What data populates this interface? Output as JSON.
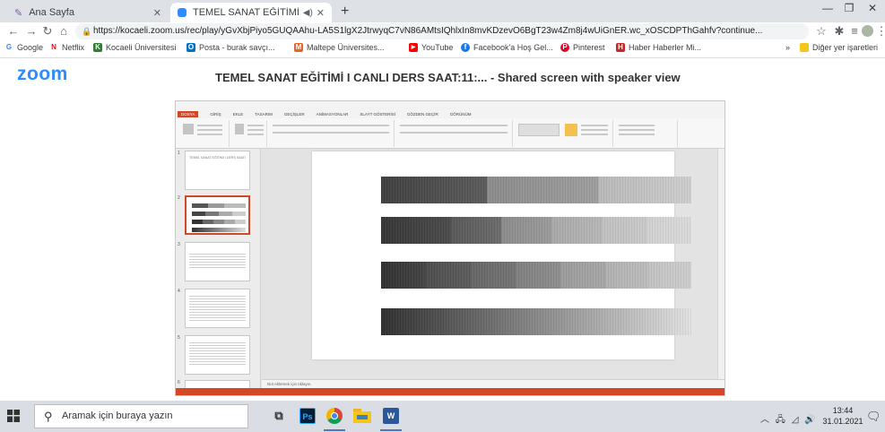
{
  "browser": {
    "tabs": [
      {
        "title": "Ana Sayfa",
        "active": false
      },
      {
        "title": "TEMEL SANAT EĞİTİMİ I CAN",
        "active": true
      }
    ],
    "url": "https://kocaeli.zoom.us/rec/play/yGvXbjPiyo5GUQAAhu-LA5S1lgX2JtrwyqC7vN86AMtsIQhlxIn8mvKDzevO6BgT23w4Zm8j4wUiGnER.wc_xOSCDPThGahfv?continue...",
    "bookmarks": [
      {
        "label": "Google",
        "color": "#4285f4",
        "glyph": "G"
      },
      {
        "label": "Netflix",
        "color": "#e50914",
        "glyph": "N"
      },
      {
        "label": "Kocaeli Üniversitesi",
        "color": "#2e7d32",
        "glyph": "K"
      },
      {
        "label": "Posta - burak savçı...",
        "color": "#0072c6",
        "glyph": "O"
      },
      {
        "label": "Maltepe Üniversites...",
        "color": "#e0662a",
        "glyph": "M"
      },
      {
        "label": "YouTube",
        "color": "#ff0000",
        "glyph": "▶"
      },
      {
        "label": "Facebook'a Hoş Gel...",
        "color": "#1877f2",
        "glyph": "f"
      },
      {
        "label": "Pinterest",
        "color": "#e60023",
        "glyph": "P"
      },
      {
        "label": "Haber Haberler Mi...",
        "color": "#c62828",
        "glyph": "H"
      }
    ],
    "bookmarks_more": "»",
    "other_bookmarks": "Diğer yer işaretleri"
  },
  "zoom": {
    "logo": "zoom",
    "title": "TEMEL SANAT EĞİTİMİ I CANLI DERS SAAT:11:... - Shared screen with speaker view"
  },
  "ppt": {
    "menu": [
      "DOSYA",
      "GİRİŞ",
      "EKLE",
      "TASARIM",
      "GEÇİŞLER",
      "ANİMASYONLAR",
      "SLAYT GÖSTERİSİ",
      "GÖZDEN GEÇİR",
      "GÖRÜNÜM"
    ],
    "notes_placeholder": "Not eklemek için tıklayın",
    "thumb1_text": "TEMEL SANAT EĞİTİMİ I DERS SAATİ",
    "colors": {
      "accent": "#d24726"
    }
  },
  "taskbar": {
    "search_placeholder": "Aramak için buraya yazın",
    "time": "13:44",
    "date": "31.01.2021",
    "apps": [
      {
        "name": "task-view",
        "glyph": "⧉"
      },
      {
        "name": "photoshop",
        "glyph": "Ps"
      },
      {
        "name": "chrome",
        "glyph": ""
      },
      {
        "name": "file-explorer",
        "glyph": ""
      },
      {
        "name": "word",
        "glyph": "W"
      }
    ]
  }
}
